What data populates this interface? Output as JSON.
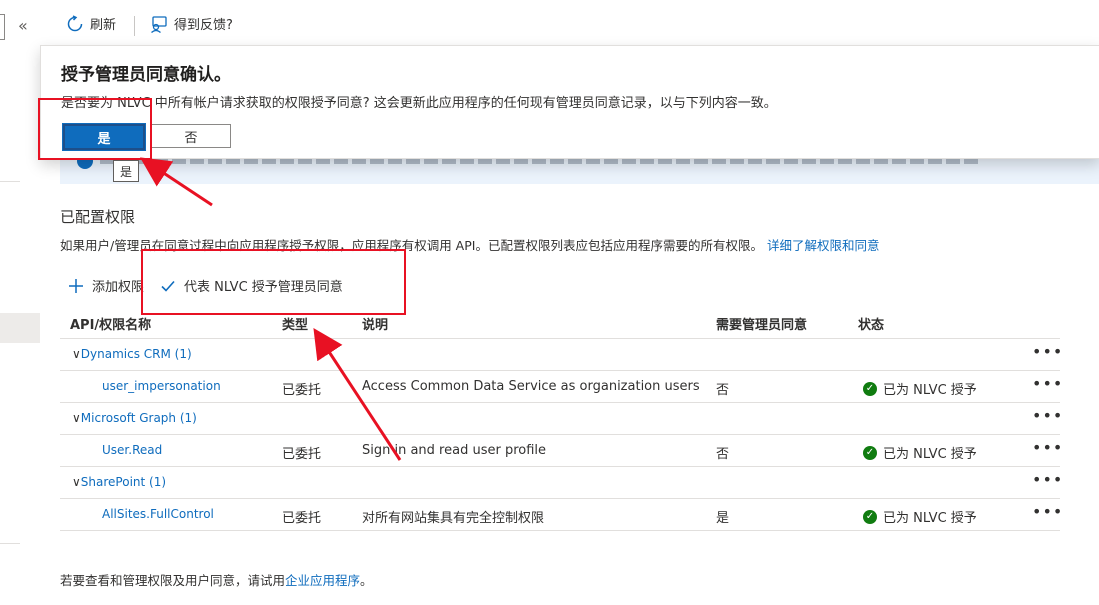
{
  "toolbar": {
    "refresh_label": "刷新",
    "feedback_label": "得到反馈?"
  },
  "sidebar": {
    "collapse_glyph": "«"
  },
  "dialog": {
    "title": "授予管理员同意确认。",
    "message": "是否要为 NLVC 中所有帐户请求获取的权限授予同意? 这会更新此应用程序的任何现有管理员同意记录，以与下列内容一致。",
    "yes_label": "是",
    "no_label": "否",
    "tooltip": "是"
  },
  "section": {
    "title": "已配置权限",
    "description": "如果用户/管理员在同意过程中向应用程序授予权限，应用程序有权调用 API。已配置权限列表应包括应用程序需要的所有权限。",
    "learn_more": "详细了解权限和同意"
  },
  "commands": {
    "add_label": "添加权限",
    "grant_label": "代表 NLVC 授予管理员同意"
  },
  "table": {
    "headers": {
      "name": "API/权限名称",
      "type": "类型",
      "desc": "说明",
      "admin": "需要管理员同意",
      "status": "状态"
    },
    "groups": [
      {
        "name": "Dynamics CRM (1)",
        "items": [
          {
            "name": "user_impersonation",
            "type": "已委托",
            "desc": "Access Common Data Service as organization users",
            "admin": "否",
            "status": "已为 NLVC 授予"
          }
        ]
      },
      {
        "name": "Microsoft Graph (1)",
        "items": [
          {
            "name": "User.Read",
            "type": "已委托",
            "desc": "Sign in and read user profile",
            "admin": "否",
            "status": "已为 NLVC 授予"
          }
        ]
      },
      {
        "name": "SharePoint (1)",
        "items": [
          {
            "name": "AllSites.FullControl",
            "type": "已委托",
            "desc": "对所有网站集具有完全控制权限",
            "admin": "是",
            "status": "已为 NLVC 授予"
          }
        ]
      }
    ],
    "more_glyph": "•••"
  },
  "footer": {
    "text": "若要查看和管理权限及用户同意，请试用",
    "link": "企业应用程序",
    "end": "。"
  },
  "colors": {
    "accent": "#0f6cbd",
    "annotation_red": "#e81123",
    "success": "#107c10"
  }
}
